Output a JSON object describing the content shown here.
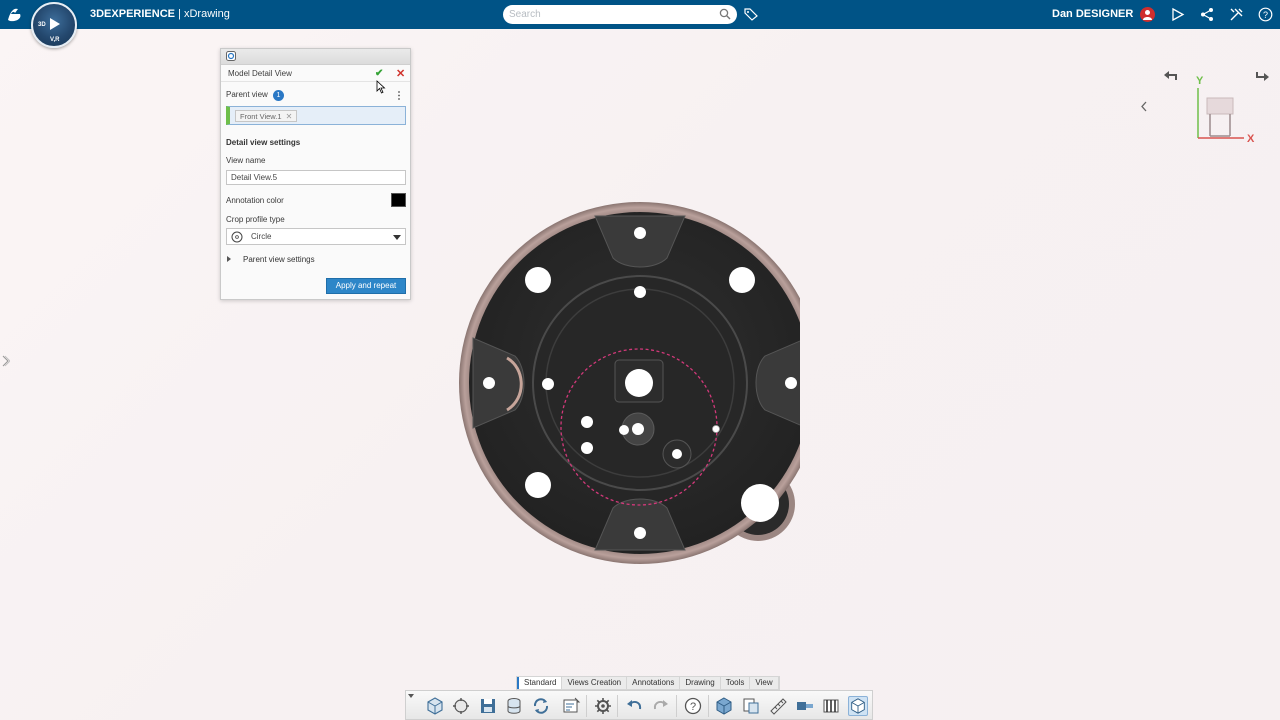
{
  "topbar": {
    "brand_logo": "3DS",
    "compass": {
      "label_3d": "3D",
      "label_vr": "V,R"
    },
    "app_brand": "3DEXPERIENCE",
    "app_separator": " | ",
    "app_name": "xDrawing",
    "search_placeholder": "Search",
    "user_name": "Dan DESIGNER",
    "bar_color": "#005386"
  },
  "dialog": {
    "title": "Model Detail View",
    "parent_view_label": "Parent view",
    "parent_view_count": "1",
    "parent_view_value": "Front View.1",
    "section_title": "Detail view settings",
    "view_name_label": "View name",
    "view_name_value": "Detail View.5",
    "annotation_color_label": "Annotation color",
    "annotation_color": "#000000",
    "crop_profile_label": "Crop profile type",
    "crop_profile_value": "Circle",
    "parent_view_settings_label": "Parent view settings",
    "apply_button": "Apply and repeat"
  },
  "viewport": {
    "triad_y_label": "Y",
    "triad_x_label": "X",
    "crop_circle_color": "#d2397a"
  },
  "action_bar": {
    "tabs": [
      "Standard",
      "Views Creation",
      "Annotations",
      "Drawing",
      "Tools",
      "View"
    ],
    "active_tab": "Standard",
    "tools": [
      "new-sheet-icon",
      "properties-icon",
      "save-icon",
      "database-icon",
      "update-icon",
      "drawing-update-icon",
      "settings-icon",
      "undo-icon",
      "redo-icon",
      "help-icon",
      "3d-view-icon",
      "sheet-icon",
      "measure-icon",
      "view-icon",
      "section-icon",
      "rendering-icon"
    ]
  }
}
